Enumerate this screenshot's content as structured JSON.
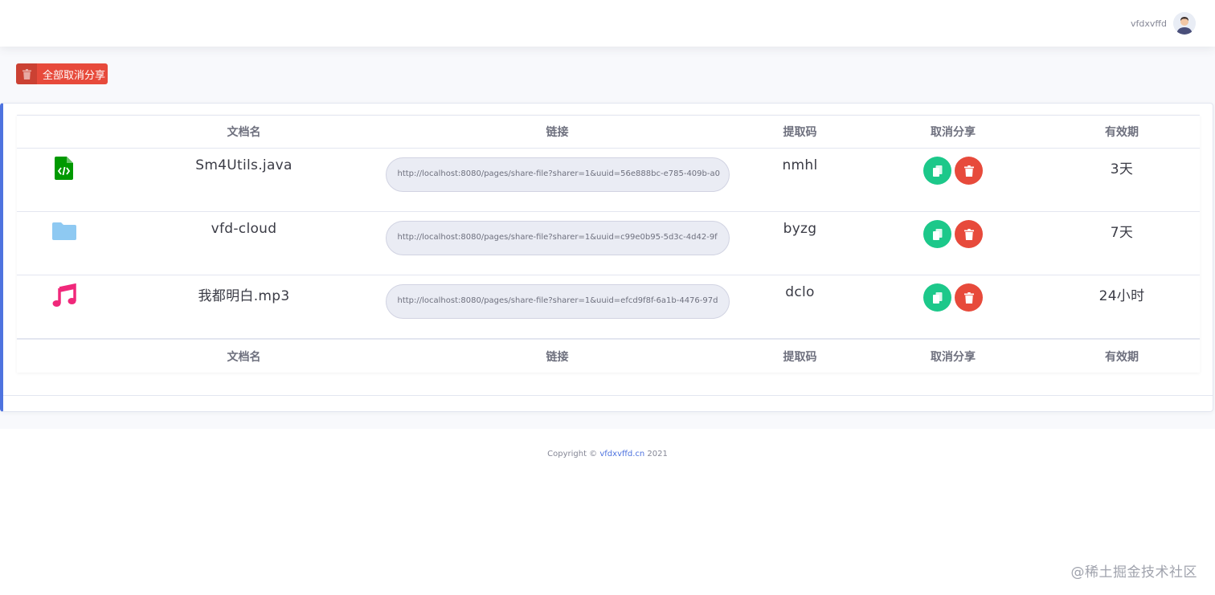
{
  "header": {
    "username": "vfdxvffd"
  },
  "toolbar": {
    "cancel_all_label": "全部取消分享"
  },
  "table": {
    "columns": [
      "文档名",
      "链接",
      "提取码",
      "取消分享",
      "有效期"
    ],
    "rows": [
      {
        "icon": "code-file-icon",
        "icon_color": "#009900",
        "name": "Sm4Utils.java",
        "link": "http://localhost:8080/pages/share-file?sharer=1&uuid=56e888bc-e785-409b-a0",
        "code": "nmhl",
        "validity": "3天"
      },
      {
        "icon": "folder-icon",
        "icon_color": "#8ec9f2",
        "name": "vfd-cloud",
        "link": "http://localhost:8080/pages/share-file?sharer=1&uuid=c99e0b95-5d3c-4d42-9f",
        "code": "byzg",
        "validity": "7天"
      },
      {
        "icon": "music-note-icon",
        "icon_color": "#f0287a",
        "name": "我都明白.mp3",
        "link": "http://localhost:8080/pages/share-file?sharer=1&uuid=efcd9f8f-6a1b-4476-97d",
        "code": "dclo",
        "validity": "24小时"
      }
    ]
  },
  "footer": {
    "copyright_prefix": "Copyright ©",
    "site": "vfdxvffd.cn",
    "year": "2021"
  },
  "watermark": "@稀土掘金技术社区",
  "colors": {
    "primary": "#4e73df",
    "success": "#1cc88a",
    "danger": "#e74a3b"
  }
}
